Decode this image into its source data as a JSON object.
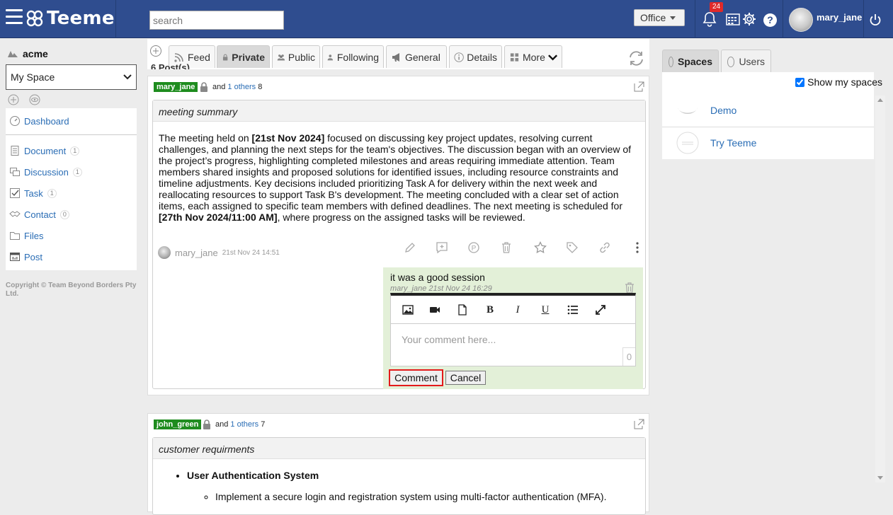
{
  "header": {
    "app_name": "Teeme",
    "search_placeholder": "search",
    "office_label": "Office",
    "notification_count": "24",
    "help_label": "?",
    "username": "mary_jane"
  },
  "sidebar": {
    "org_name": "acme",
    "space_selected": "My Space",
    "items": [
      {
        "label": "Dashboard",
        "count": ""
      },
      {
        "label": "Document",
        "count": "1"
      },
      {
        "label": "Discussion",
        "count": "1"
      },
      {
        "label": "Task",
        "count": "1"
      },
      {
        "label": "Contact",
        "count": "0"
      },
      {
        "label": "Files",
        "count": ""
      },
      {
        "label": "Post",
        "count": ""
      }
    ],
    "copyright": "Copyright © Team Beyond Borders Pty Ltd."
  },
  "tabs": [
    {
      "label": "Feed"
    },
    {
      "label": "Private"
    },
    {
      "label": "Public"
    },
    {
      "label": "Following"
    },
    {
      "label": "General"
    },
    {
      "label": "Details"
    },
    {
      "label": "More"
    }
  ],
  "posts_count": "6 Post(s)",
  "posts": [
    {
      "owner": "mary_jane",
      "and_text": "and",
      "others_link": "1 others",
      "others_count": "8",
      "title": "meeting summary",
      "body_parts": {
        "p1": "The meeting held on ",
        "b1": "[21st Nov 2024]",
        "p2": " focused on discussing key project updates, resolving current challenges, and planning the next steps for the team's objectives. The discussion began with an overview of the project’s progress, highlighting completed milestones and areas requiring immediate attention. Team members shared insights and proposed solutions for identified issues, including resource constraints and timeline adjustments. Key decisions included prioritizing Task A for delivery within the next week and reallocating resources to support Task B's development. The meeting concluded with a clear set of action items, each assigned to specific team members with defined deadlines. The next meeting is scheduled for ",
        "b2": "[27th Nov 2024/11:00 AM]",
        "p3": ", where progress on the assigned tasks will be reviewed."
      },
      "author": "mary_jane",
      "time": "21st Nov 24 14:51",
      "comment": {
        "text": "it was a good session",
        "meta": "mary_jane 21st Nov 24 16:29",
        "placeholder": "Your comment here...",
        "char_count": "0",
        "comment_button": "Comment",
        "cancel_button": "Cancel"
      }
    },
    {
      "owner": "john_green",
      "and_text": "and",
      "others_link": "1 others",
      "others_count": "7",
      "title": "customer requirments",
      "list_heading": "User Authentication System",
      "list_item": "Implement a secure login and registration system using multi-factor authentication (MFA)."
    }
  ],
  "right_panel": {
    "tabs": [
      {
        "label": "Spaces"
      },
      {
        "label": "Users"
      }
    ],
    "show_my_spaces_label": "Show my spaces",
    "spaces": [
      {
        "name": "Demo"
      },
      {
        "name": "Try Teeme"
      }
    ]
  },
  "colors": {
    "topbar": "#2f4d8f",
    "owner_badge": "#1e8c1e",
    "comment_bg": "#e3f0d8",
    "link": "#2a6db5",
    "highlight": "#e31b1b"
  }
}
